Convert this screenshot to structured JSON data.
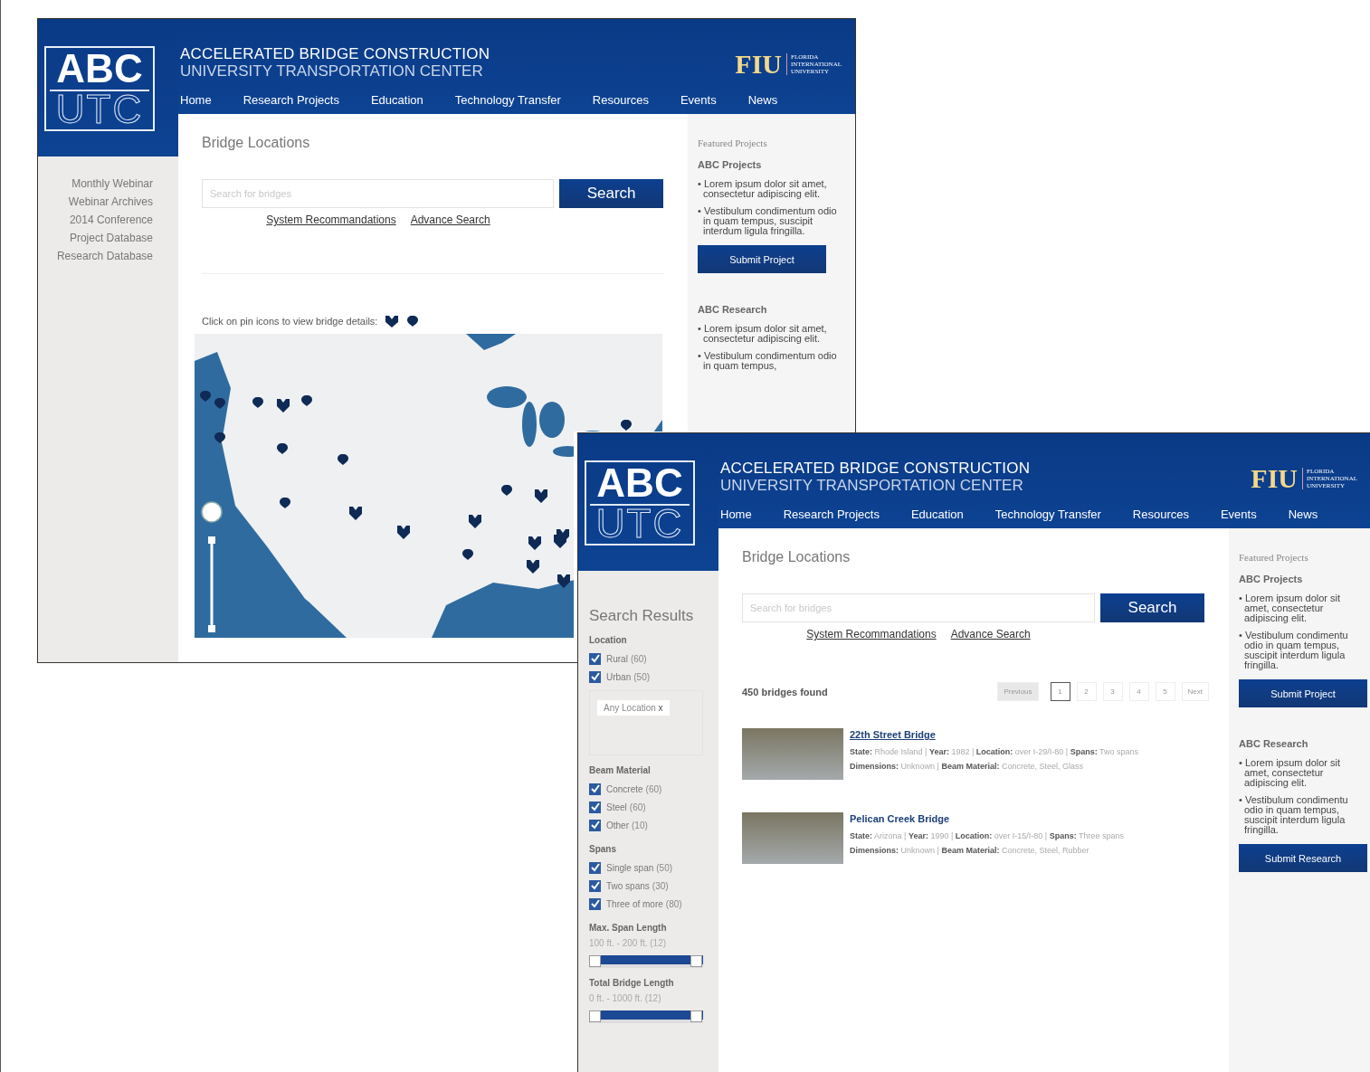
{
  "map_page": {
    "header": {
      "logo_top": "ABC",
      "logo_bottom": "UTC",
      "title": "ACCELERATED BRIDGE CONSTRUCTION",
      "subtitle": "UNIVERSITY TRANSPORTATION CENTER",
      "fiu_mark": "FIU",
      "fiu_name": [
        "FLORIDA",
        "INTERNATIONAL",
        "UNIVERSITY"
      ]
    },
    "nav": [
      "Home",
      "Research Projects",
      "Education",
      "Technology Transfer",
      "Resources",
      "Events",
      "News"
    ],
    "sidebar_links": [
      "Monthly Webinar",
      "Webinar Archives",
      "2014 Conference",
      "Project Database",
      "Research Database"
    ],
    "page_title": "Bridge Locations",
    "search": {
      "placeholder": "Search for bridges",
      "button": "Search",
      "links": [
        "System Recommandations",
        "Advance Search"
      ]
    },
    "map": {
      "caption": "Click on pin icons to view bridge details:"
    },
    "featured": {
      "heading": "Featured Projects",
      "sections": [
        {
          "title": "ABC Projects",
          "items": [
            "• Lorem ipsum dolor sit amet, consectetur adipiscing elit.",
            "• Vestibulum condimentum odio in quam tempus, suscipit interdum ligula fringilla."
          ],
          "button": "Submit Project"
        },
        {
          "title": "ABC Research",
          "items": [
            "• Lorem ipsum dolor sit amet, consectetur adipiscing elit.",
            "• Vestibulum condimentum odio in quam tempus,"
          ]
        }
      ]
    }
  },
  "results_page": {
    "header": {
      "logo_top": "ABC",
      "logo_bottom": "UTC",
      "title": "ACCELERATED BRIDGE CONSTRUCTION",
      "subtitle": "UNIVERSITY TRANSPORTATION CENTER",
      "fiu_mark": "FIU",
      "fiu_name": [
        "FLORIDA",
        "INTERNATIONAL",
        "UNIVERSITY"
      ]
    },
    "nav": [
      "Home",
      "Research Projects",
      "Education",
      "Technology Transfer",
      "Resources",
      "Events",
      "News"
    ],
    "sidebar_title": "Search Results",
    "filters": [
      {
        "title": "Location",
        "kind": "checkboxes",
        "options": [
          {
            "label": "Rural",
            "count": "(60)",
            "checked": true
          },
          {
            "label": "Urban",
            "count": "(50)",
            "checked": true
          }
        ],
        "tag": {
          "label": "Any Location",
          "remove": "x"
        }
      },
      {
        "title": "Beam Material",
        "kind": "checkboxes",
        "options": [
          {
            "label": "Concrete",
            "count": "(60)",
            "checked": true
          },
          {
            "label": "Steel",
            "count": "(60)",
            "checked": true
          },
          {
            "label": "Other",
            "count": "(10)",
            "checked": true
          }
        ]
      },
      {
        "title": "Spans",
        "kind": "checkboxes",
        "options": [
          {
            "label": "Single span",
            "count": "(50)",
            "checked": true
          },
          {
            "label": "Two spans",
            "count": "(30)",
            "checked": true
          },
          {
            "label": "Three of more",
            "count": "(80)",
            "checked": true
          }
        ]
      },
      {
        "title": "Max. Span Length",
        "kind": "range",
        "reading": "100 ft. - 200 ft. (12)",
        "level": 1
      },
      {
        "title": "Total Bridge Length",
        "kind": "range",
        "reading": "0 ft. - 1000 ft. (12)",
        "level": 1
      }
    ],
    "page_title": "Bridge Locations",
    "search": {
      "placeholder": "Search for bridges",
      "button": "Search",
      "links": [
        "System Recommandations",
        "Advance Search"
      ]
    },
    "results_count": "450 bridges found",
    "pagination": {
      "previous": "Previous",
      "previous_disabled": true,
      "pages": [
        {
          "label": "1",
          "selected": true
        },
        {
          "label": "2",
          "selected": false
        },
        {
          "label": "3",
          "selected": false
        },
        {
          "label": "4",
          "selected": false
        },
        {
          "label": "5",
          "selected": false
        }
      ],
      "next": "Next"
    },
    "results": [
      {
        "title": "22th Street Bridge",
        "underlined": true,
        "details": [
          "**State:** Rhode Island | **Year:** 1982 | **Location:** over I-29/I-80 | **Spans:** Two spans",
          "**Dimensions:** Unknown | **Beam Material:** Concrete, Steel, Glass"
        ]
      },
      {
        "title": "Pelican Creek Bridge",
        "underlined": false,
        "details": [
          "**State:** Arizona | **Year:** 1990 | **Location:** over I-15/I-80 | **Spans:** Three spans",
          "**Dimensions:** Unknown | **Beam Material:** Concrete, Steel, Rubber"
        ]
      }
    ],
    "featured": {
      "heading": "Featured Projects",
      "sections": [
        {
          "title": "ABC Projects",
          "items": [
            "• Lorem ipsum dolor sit amet, consectetur adipiscing elit.",
            "• Vestibulum condimentu odio in quam tempus, suscipit interdum ligula fringilla."
          ],
          "button": "Submit Project"
        },
        {
          "title": "ABC Research",
          "items": [
            "• Lorem ipsum dolor sit amet, consectetur adipiscing elit.",
            "• Vestibulum condimentu odio in quam tempus, suscipit interdum ligula fringilla."
          ],
          "button": "Submit Research"
        }
      ]
    }
  }
}
